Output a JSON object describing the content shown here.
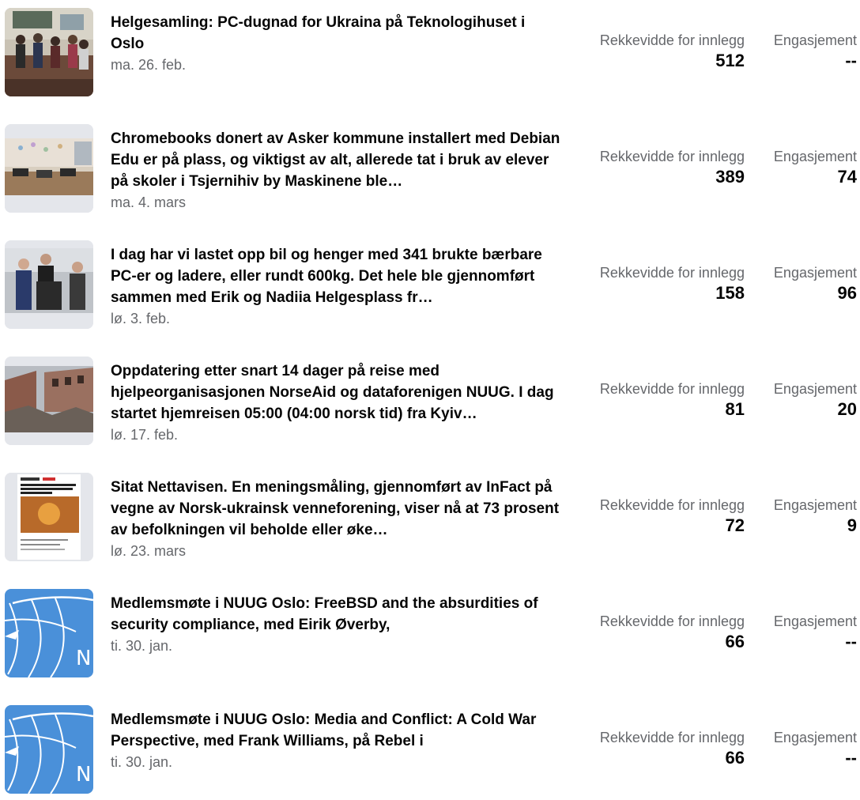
{
  "posts": [
    {
      "title": "Helgesamling: PC-dugnad for Ukraina på Teknologihuset i Oslo",
      "date": "ma. 26. feb.",
      "reach_label": "Rekkevidde for innlegg",
      "reach": "512",
      "engagement_label": "Engasjement",
      "engagement": "--",
      "thumb": "classroom-group-photo"
    },
    {
      "title": "Chromebooks donert av Asker kommune installert med Debian Edu er på plass, og viktigst av alt, allerede tat i bruk av elever på skoler i Tsjernihiv by Maskinene ble…",
      "date": "ma. 4. mars",
      "reach_label": "Rekkevidde for innlegg",
      "reach": "389",
      "engagement_label": "Engasjement",
      "engagement": "74",
      "thumb": "classroom-photo"
    },
    {
      "title": "I dag har vi lastet opp bil og henger med 341 brukte bærbare PC-er og ladere, eller rundt 600kg. Det hele ble gjennomført sammen med Erik og Nadiia Helgesplass fr…",
      "date": "lø. 3. feb.",
      "reach_label": "Rekkevidde for innlegg",
      "reach": "158",
      "engagement_label": "Engasjement",
      "engagement": "96",
      "thumb": "people-loading-photo"
    },
    {
      "title": "Oppdatering etter snart 14 dager på reise med hjelpeorganisasjonen NorseAid og dataforenigen NUUG. I dag startet hjemreisen 05:00 (04:00 norsk tid) fra Kyiv…",
      "date": "lø. 17. feb.",
      "reach_label": "Rekkevidde for innlegg",
      "reach": "81",
      "engagement_label": "Engasjement",
      "engagement": "20",
      "thumb": "ruined-building-photo"
    },
    {
      "title": "Sitat Nettavisen. En meningsmåling, gjennomført av InFact på vegne av Norsk-ukrainsk venneforening, viser nå at 73 prosent av befolkningen vil beholde eller øke…",
      "date": "lø. 23. mars",
      "reach_label": "Rekkevidde for innlegg",
      "reach": "72",
      "engagement_label": "Engasjement",
      "engagement": "9",
      "thumb": "news-article-screenshot"
    },
    {
      "title": "Medlemsmøte i NUUG Oslo: FreeBSD and the absurdities of security compliance, med Eirik Øverby,",
      "date": "ti. 30. jan.",
      "reach_label": "Rekkevidde for innlegg",
      "reach": "66",
      "engagement_label": "Engasjement",
      "engagement": "--",
      "thumb": "nuug-logo"
    },
    {
      "title": "Medlemsmøte i NUUG Oslo: Media and Conflict: A Cold War Perspective, med Frank Williams, på Rebel i",
      "date": "ti. 30. jan.",
      "reach_label": "Rekkevidde for innlegg",
      "reach": "66",
      "engagement_label": "Engasjement",
      "engagement": "--",
      "thumb": "nuug-logo"
    }
  ],
  "colors": {
    "text_primary": "#050505",
    "text_secondary": "#65676b",
    "nuug_blue": "#4a90d9"
  }
}
